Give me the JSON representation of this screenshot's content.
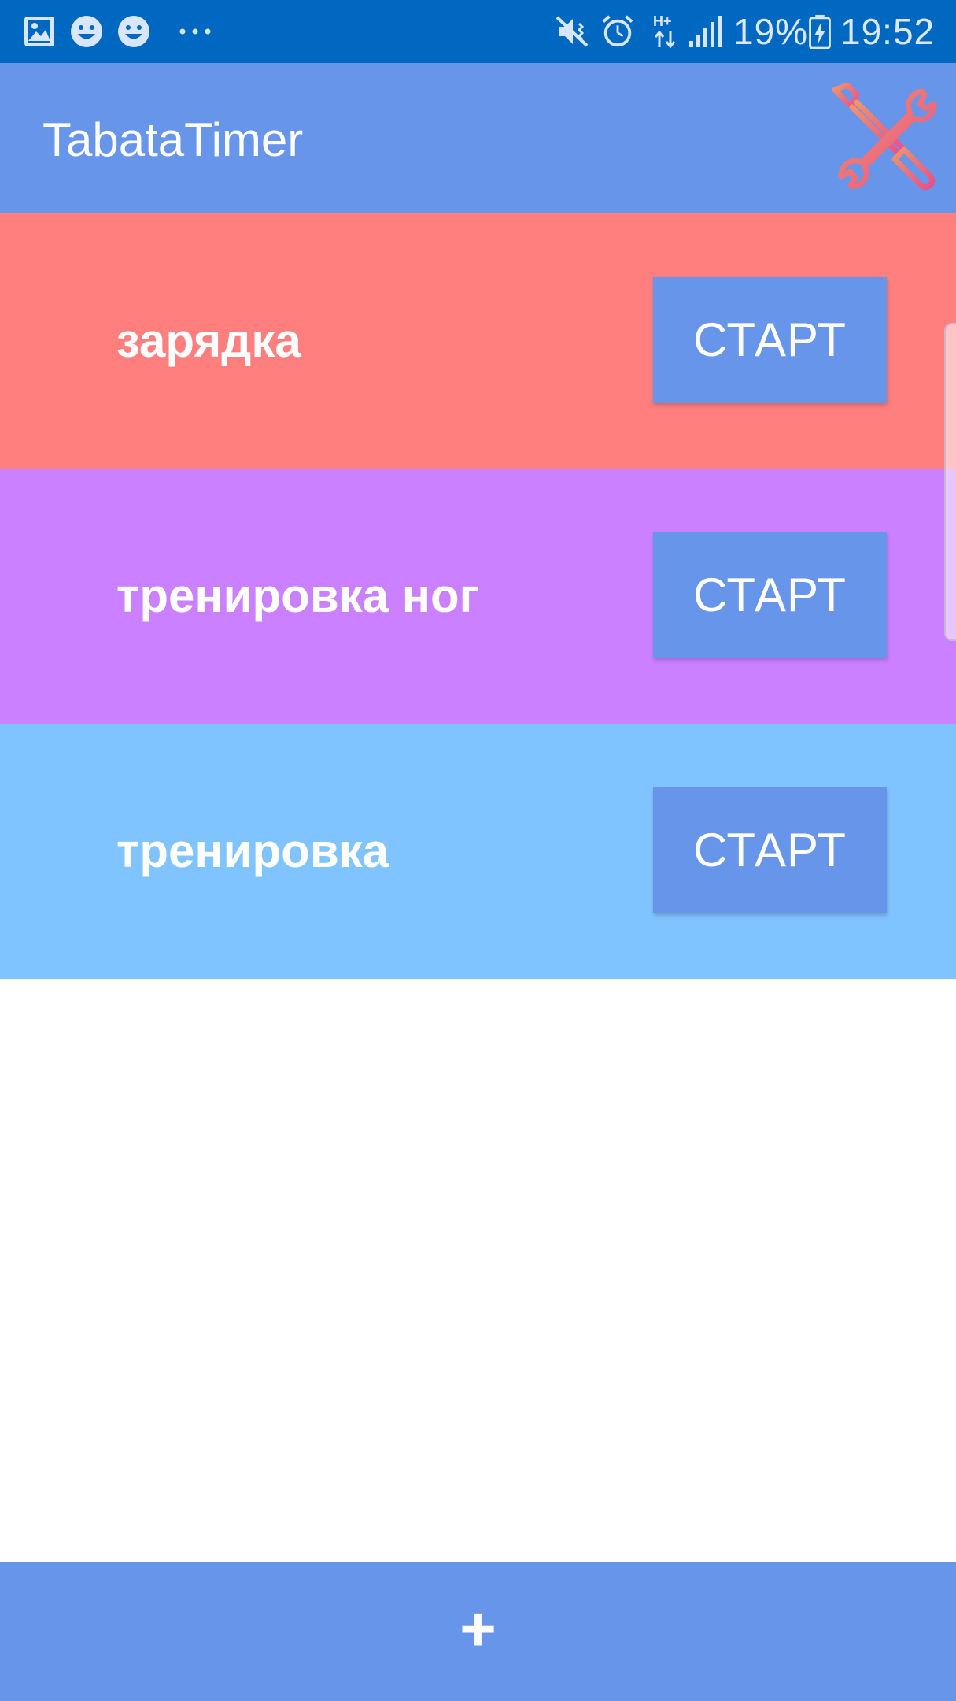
{
  "status_bar": {
    "battery_percent": "19%",
    "time": "19:52",
    "network_type": "H+",
    "left_icons": [
      "gallery-icon",
      "emoji-icon",
      "emoji-icon",
      "more-dots-icon"
    ],
    "right_icons": [
      "mute-icon",
      "alarm-icon",
      "data-arrows-icon",
      "signal-icon",
      "battery-charging-icon"
    ],
    "background_color": "#0068c0"
  },
  "app_bar": {
    "title": "TabataTimer",
    "settings_icon": "tools-icon",
    "background_color": "#6795ea",
    "icon_color": "#ee6a82"
  },
  "workouts": [
    {
      "name": "зарядка",
      "start_label": "СТАРТ",
      "color": "#ff7f7f"
    },
    {
      "name": "тренировка ног",
      "start_label": "СТАРТ",
      "color": "#cb80ff"
    },
    {
      "name": "тренировка",
      "start_label": "СТАРТ",
      "color": "#80c4ff"
    }
  ],
  "add_button": {
    "label": "+",
    "background_color": "#6795ea"
  }
}
